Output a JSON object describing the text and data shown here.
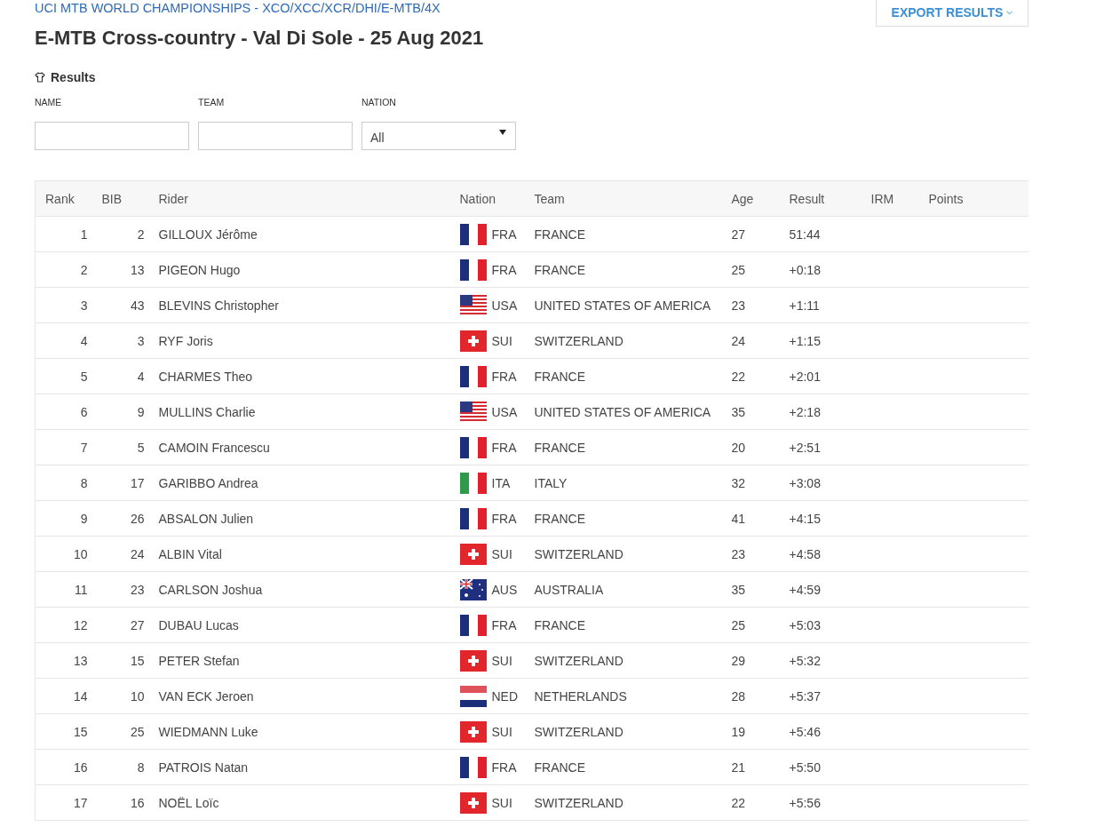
{
  "breadcrumb": "UCI MTB WORLD CHAMPIONSHIPS - XCO/XCC/XCR/DHI/E-MTB/4X",
  "export_button": {
    "label": "EXPORT RESULTS"
  },
  "title": "E-MTB Cross-country - Val Di Sole - 25 Aug 2021",
  "section": "Results",
  "filters": [
    {
      "kind": "text",
      "label": "NAME"
    },
    {
      "kind": "text",
      "label": "TEAM"
    },
    {
      "kind": "select",
      "label": "NATION",
      "value": "All"
    }
  ],
  "table": {
    "columns": [
      "Rank",
      "BIB",
      "Rider",
      "Nation",
      "Team",
      "Age",
      "Result",
      "IRM",
      "Points"
    ],
    "rows": [
      {
        "rank": "1",
        "bib": "2",
        "rider": "GILLOUX Jérôme",
        "kind": "fr",
        "nation": "FRA",
        "team": "FRANCE",
        "age": "27",
        "result": "51:44"
      },
      {
        "rank": "2",
        "bib": "13",
        "rider": "PIGEON Hugo",
        "kind": "fr",
        "nation": "FRA",
        "team": "FRANCE",
        "age": "25",
        "result": "+0:18"
      },
      {
        "rank": "3",
        "bib": "43",
        "rider": "BLEVINS Christopher",
        "kind": "us",
        "nation": "USA",
        "team": "UNITED STATES OF AMERICA",
        "age": "23",
        "result": "+1:11"
      },
      {
        "rank": "4",
        "bib": "3",
        "rider": "RYF Joris",
        "kind": "ch",
        "nation": "SUI",
        "team": "SWITZERLAND",
        "age": "24",
        "result": "+1:15"
      },
      {
        "rank": "5",
        "bib": "4",
        "rider": "CHARMES Theo",
        "kind": "fr",
        "nation": "FRA",
        "team": "FRANCE",
        "age": "22",
        "result": "+2:01"
      },
      {
        "rank": "6",
        "bib": "9",
        "rider": "MULLINS Charlie",
        "kind": "us",
        "nation": "USA",
        "team": "UNITED STATES OF AMERICA",
        "age": "35",
        "result": "+2:18"
      },
      {
        "rank": "7",
        "bib": "5",
        "rider": "CAMOIN Francescu",
        "kind": "fr",
        "nation": "FRA",
        "team": "FRANCE",
        "age": "20",
        "result": "+2:51"
      },
      {
        "rank": "8",
        "bib": "17",
        "rider": "GARIBBO Andrea",
        "kind": "it",
        "nation": "ITA",
        "team": "ITALY",
        "age": "32",
        "result": "+3:08"
      },
      {
        "rank": "9",
        "bib": "26",
        "rider": "ABSALON Julien",
        "kind": "fr",
        "nation": "FRA",
        "team": "FRANCE",
        "age": "41",
        "result": "+4:15"
      },
      {
        "rank": "10",
        "bib": "24",
        "rider": "ALBIN Vital",
        "kind": "ch",
        "nation": "SUI",
        "team": "SWITZERLAND",
        "age": "23",
        "result": "+4:58"
      },
      {
        "rank": "11",
        "bib": "23",
        "rider": "CARLSON Joshua",
        "kind": "au",
        "nation": "AUS",
        "team": "AUSTRALIA",
        "age": "35",
        "result": "+4:59"
      },
      {
        "rank": "12",
        "bib": "27",
        "rider": "DUBAU Lucas",
        "kind": "fr",
        "nation": "FRA",
        "team": "FRANCE",
        "age": "25",
        "result": "+5:03"
      },
      {
        "rank": "13",
        "bib": "15",
        "rider": "PETER Stefan",
        "kind": "ch",
        "nation": "SUI",
        "team": "SWITZERLAND",
        "age": "29",
        "result": "+5:32"
      },
      {
        "rank": "14",
        "bib": "10",
        "rider": "VAN ECK Jeroen",
        "kind": "nl",
        "nation": "NED",
        "team": "NETHERLANDS",
        "age": "28",
        "result": "+5:37"
      },
      {
        "rank": "15",
        "bib": "25",
        "rider": "WIEDMANN Luke",
        "kind": "ch",
        "nation": "SUI",
        "team": "SWITZERLAND",
        "age": "19",
        "result": "+5:46"
      },
      {
        "rank": "16",
        "bib": "8",
        "rider": "PATROIS Natan",
        "kind": "fr",
        "nation": "FRA",
        "team": "FRANCE",
        "age": "21",
        "result": "+5:50"
      },
      {
        "rank": "17",
        "bib": "16",
        "rider": "NOËL Loïc",
        "kind": "ch",
        "nation": "SUI",
        "team": "SWITZERLAND",
        "age": "22",
        "result": "+5:56"
      }
    ]
  }
}
